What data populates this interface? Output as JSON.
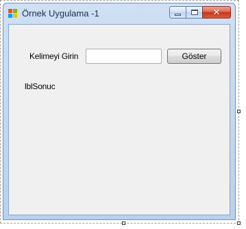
{
  "window": {
    "title": "Örnek Uygulama -1",
    "close_glyph": "✕"
  },
  "form": {
    "prompt_label": "Kelimeyi Girin",
    "input_value": "",
    "button_label": "Göster",
    "result_label": "lblSonuc"
  },
  "icons": {
    "app": "windows-form-icon",
    "minimize": "minimize-icon",
    "maximize": "maximize-icon",
    "close": "close-icon"
  },
  "colors": {
    "title_bar": "#b9d1ee",
    "client_area": "#f0f0f0",
    "close_button": "#c2361b"
  }
}
